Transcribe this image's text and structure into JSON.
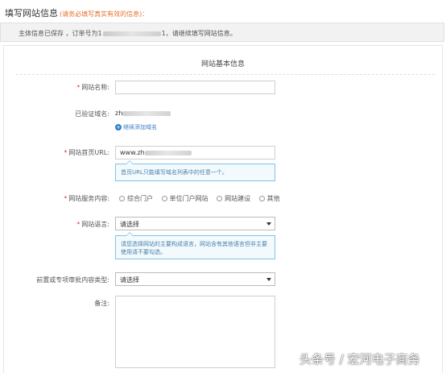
{
  "header": {
    "title": "填写网站信息",
    "note": "(请务必填写真实有效的信息)：",
    "notice_prefix": "主体信息已保存 ，订单号为",
    "order_no_start": "1",
    "order_no_end": "1",
    "notice_suffix": "，请继续填写网站信息。"
  },
  "section": {
    "title": "网站基本信息"
  },
  "fields": {
    "site_name": {
      "label": "网站名称:",
      "value": ""
    },
    "verified_domain": {
      "label": "已验证域名:",
      "value_prefix": "zh"
    },
    "add_domain": "继续添加域名",
    "homepage_url": {
      "label": "网站首页URL:",
      "value_prefix": "www.zh",
      "tip": "首页URL只能填写域名列表中的任意一个。"
    },
    "service_content": {
      "label": "网站服务内容:",
      "options": [
        "综合门户",
        "单位门户网站",
        "网站建设",
        "其他"
      ]
    },
    "language": {
      "label": "网站语言:",
      "value": "请选择",
      "tip": "请您选择网站的主要构成语言，网站含有其他语言但非主要使用请不要勾选。"
    },
    "pre_approval": {
      "label": "前置或专项审批内容类型:",
      "value": "请选择"
    },
    "remark": {
      "label": "备注:"
    }
  },
  "watermark": "头条号 / 宏河电子商务",
  "colors": {
    "required": "#e4372e",
    "note": "#e4722e",
    "link": "#3a7fc1",
    "tip_border": "#7ec3e6"
  }
}
